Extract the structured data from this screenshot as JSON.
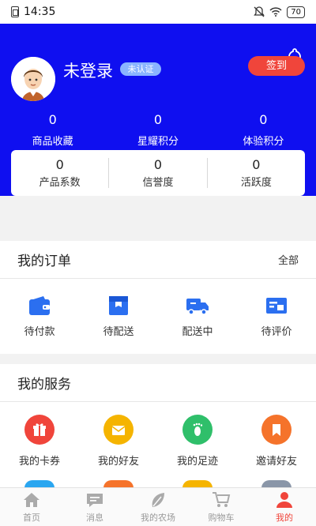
{
  "status_bar": {
    "time": "14:35",
    "battery": "70"
  },
  "header": {
    "user_name": "未登录",
    "verify_badge": "未认证",
    "checkin_label": "签到",
    "stats": [
      {
        "value": "0",
        "label": "商品收藏"
      },
      {
        "value": "0",
        "label": "星耀积分"
      },
      {
        "value": "0",
        "label": "体验积分"
      }
    ],
    "card": [
      {
        "value": "0",
        "label": "产品系数"
      },
      {
        "value": "0",
        "label": "信誉度"
      },
      {
        "value": "0",
        "label": "活跃度"
      }
    ]
  },
  "orders": {
    "title": "我的订单",
    "all_label": "全部",
    "items": [
      {
        "label": "待付款",
        "icon": "wallet-icon"
      },
      {
        "label": "待配送",
        "icon": "package-icon"
      },
      {
        "label": "配送中",
        "icon": "truck-icon"
      },
      {
        "label": "待评价",
        "icon": "review-icon"
      }
    ]
  },
  "services": {
    "title": "我的服务",
    "items": [
      {
        "label": "我的卡券",
        "icon": "gift-icon",
        "color": "#f0453b"
      },
      {
        "label": "我的好友",
        "icon": "envelope-icon",
        "color": "#f5b400"
      },
      {
        "label": "我的足迹",
        "icon": "footprint-icon",
        "color": "#2fbf6a"
      },
      {
        "label": "邀请好友",
        "icon": "bookmark-icon",
        "color": "#f5732b"
      }
    ],
    "next_row_colors": [
      "#2aa6f0",
      "#f5732b",
      "#f5b400",
      "#8a96a8"
    ]
  },
  "tabbar": {
    "tabs": [
      {
        "label": "首页",
        "icon": "home-icon"
      },
      {
        "label": "消息",
        "icon": "message-icon"
      },
      {
        "label": "我的农场",
        "icon": "leaf-icon"
      },
      {
        "label": "购物车",
        "icon": "cart-icon"
      },
      {
        "label": "我的",
        "icon": "profile-icon"
      }
    ],
    "active_color": "#f0453b",
    "inactive_color": "#aaaaaa"
  },
  "colors": {
    "header_blue": "#0f0ff0",
    "accent_blue": "#2b6ff0"
  }
}
